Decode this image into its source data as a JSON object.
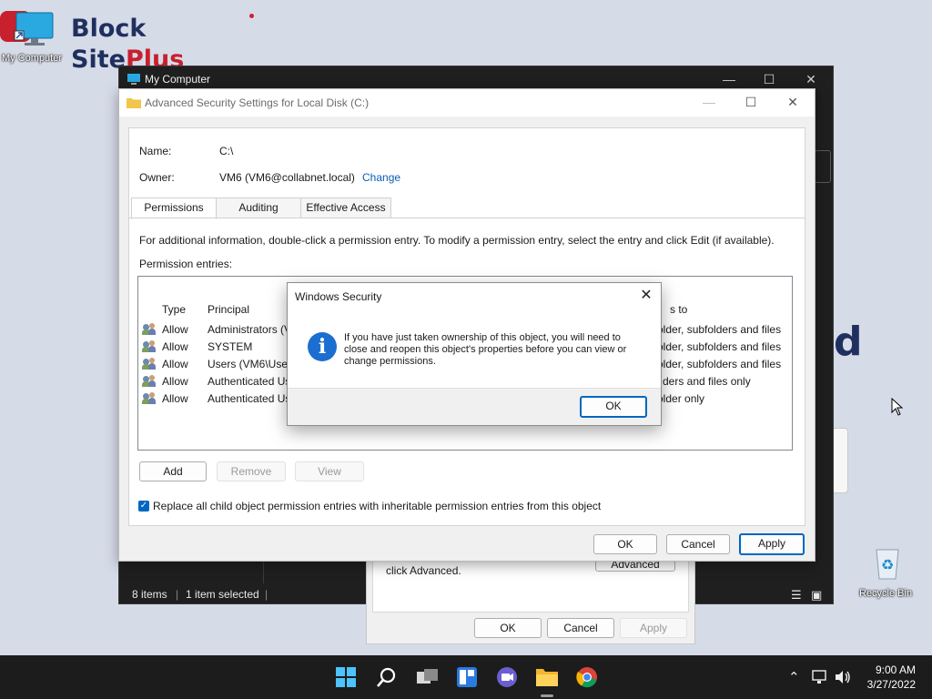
{
  "desktop": {
    "logo": {
      "word1": "Block",
      "word2": "Site",
      "word3": "Plus"
    },
    "my_computer_label": "My Computer",
    "recycle_bin_label": "Recycle Bin",
    "bg_letter": "d"
  },
  "explorer": {
    "title": "My Computer",
    "status_items": "8 items",
    "status_selected": "1 item selected"
  },
  "properties_dialog": {
    "text": "click Advanced.",
    "advanced_button": "Advanced",
    "ok_button": "OK",
    "cancel_button": "Cancel",
    "apply_button": "Apply"
  },
  "advanced_security": {
    "title": "Advanced Security Settings for Local Disk (C:)",
    "name_label": "Name:",
    "name_value": "C:\\",
    "owner_label": "Owner:",
    "owner_value": "VM6 (VM6@collabnet.local)",
    "change_link": "Change",
    "tabs": [
      "Permissions",
      "Auditing",
      "Effective Access"
    ],
    "info_text": "For additional information, double-click a permission entry. To modify a permission entry, select the entry and click Edit (if available).",
    "entries_label": "Permission entries:",
    "columns": {
      "type": "Type",
      "principal": "Principal",
      "applies": "s to"
    },
    "entries": [
      {
        "type": "Allow",
        "principal": "Administrators (V",
        "applies": "older, subfolders and files"
      },
      {
        "type": "Allow",
        "principal": "SYSTEM",
        "applies": "older, subfolders and files"
      },
      {
        "type": "Allow",
        "principal": "Users (VM6\\User",
        "applies": "older, subfolders and files"
      },
      {
        "type": "Allow",
        "principal": "Authenticated Us",
        "applies": "ders and files only"
      },
      {
        "type": "Allow",
        "principal": "Authenticated Us",
        "applies": "older only"
      }
    ],
    "add_button": "Add",
    "remove_button": "Remove",
    "view_button": "View",
    "replace_checkbox_label": "Replace all child object permission entries with inheritable permission entries from this object",
    "replace_checked": true,
    "ok_button": "OK",
    "cancel_button": "Cancel",
    "apply_button": "Apply"
  },
  "security_modal": {
    "title": "Windows Security",
    "message": "If you have just taken ownership of this object, you will need to close and reopen this object's properties before you can view or change permissions.",
    "ok_button": "OK"
  },
  "taskbar": {
    "time": "9:00 AM",
    "date": "3/27/2022"
  },
  "colors": {
    "accent": "#0067c0",
    "link": "#0a5fb4",
    "desktop_bg": "#d6dbe8"
  }
}
